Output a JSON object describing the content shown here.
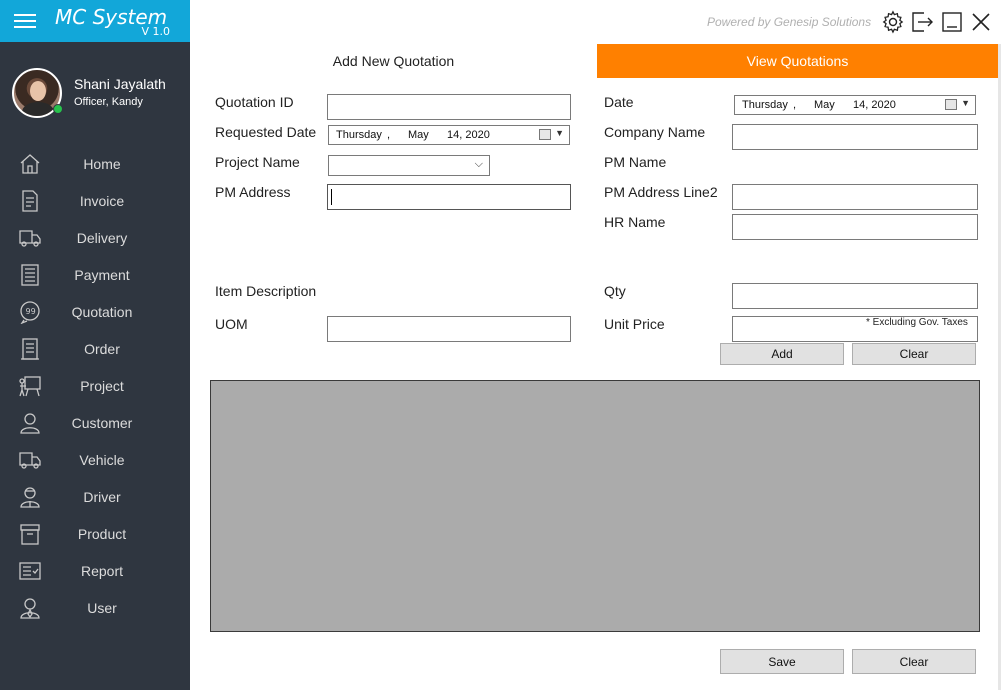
{
  "app": {
    "title": "MC System",
    "version": "V 1.0",
    "powered_by": "Powered by Genesip Solutions"
  },
  "user": {
    "name": "Shani Jayalath",
    "role": "Officer, Kandy"
  },
  "nav": [
    {
      "label": "Home",
      "icon": "home-icon"
    },
    {
      "label": "Invoice",
      "icon": "invoice-icon"
    },
    {
      "label": "Delivery",
      "icon": "delivery-truck-icon"
    },
    {
      "label": "Payment",
      "icon": "payment-icon"
    },
    {
      "label": "Quotation",
      "icon": "quotation-icon"
    },
    {
      "label": "Order",
      "icon": "order-icon"
    },
    {
      "label": "Project",
      "icon": "project-icon"
    },
    {
      "label": "Customer",
      "icon": "customer-icon"
    },
    {
      "label": "Vehicle",
      "icon": "vehicle-icon"
    },
    {
      "label": "Driver",
      "icon": "driver-icon"
    },
    {
      "label": "Product",
      "icon": "product-icon"
    },
    {
      "label": "Report",
      "icon": "report-icon"
    },
    {
      "label": "User",
      "icon": "user-icon"
    }
  ],
  "tabs": {
    "add": "Add New Quotation",
    "view": "View Quotations"
  },
  "form": {
    "quotation_id": {
      "label": "Quotation ID",
      "value": ""
    },
    "requested_date": {
      "label": "Requested Date",
      "day": "Thursday",
      "sep": ",",
      "month": "May",
      "date": "14, 2020"
    },
    "project_name": {
      "label": "Project Name",
      "value": ""
    },
    "pm_address": {
      "label": "PM Address",
      "value": ""
    },
    "date": {
      "label": "Date",
      "day": "Thursday",
      "sep": ",",
      "month": "May",
      "date": "14, 2020"
    },
    "company_name": {
      "label": "Company Name",
      "value": ""
    },
    "pm_name": {
      "label": "PM Name"
    },
    "pm_address_line2": {
      "label": "PM Address Line2",
      "value": ""
    },
    "hr_name": {
      "label": "HR Name",
      "value": ""
    },
    "item_description": {
      "label": "Item Description"
    },
    "uom": {
      "label": "UOM",
      "value": ""
    },
    "qty": {
      "label": "Qty",
      "value": ""
    },
    "unit_price": {
      "label": "Unit Price",
      "value": "",
      "note": "* Excluding Gov. Taxes"
    }
  },
  "buttons": {
    "add": "Add",
    "clear_item": "Clear",
    "save": "Save",
    "clear_form": "Clear"
  },
  "colors": {
    "sidebar": "#2f3640",
    "brand": "#12a7d9",
    "active_tab": "#ff8000",
    "grid": "#ababab"
  }
}
